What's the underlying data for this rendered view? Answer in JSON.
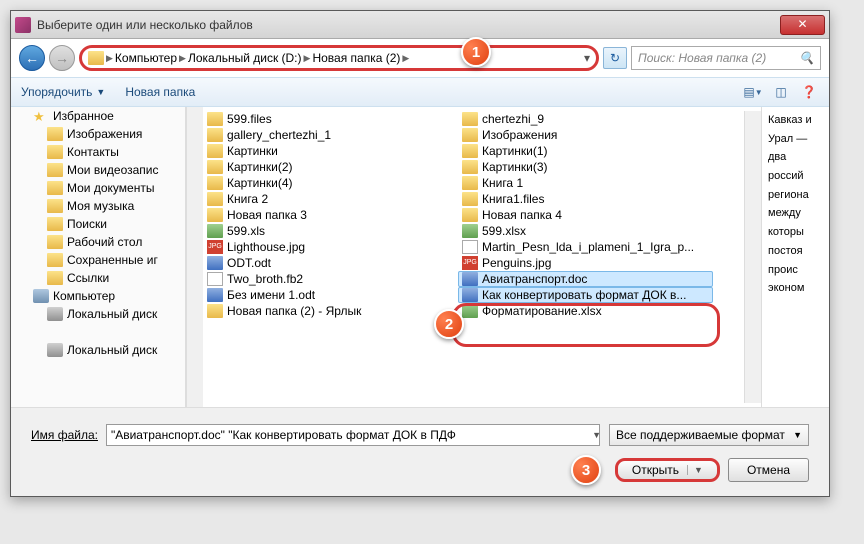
{
  "title": "Выберите один или несколько файлов",
  "breadcrumb": [
    "Компьютер",
    "Локальный диск (D:)",
    "Новая папка (2)"
  ],
  "search_placeholder": "Поиск: Новая папка (2)",
  "toolbar": {
    "organize": "Упорядочить",
    "newfolder": "Новая папка"
  },
  "sidebar": [
    {
      "label": "Избранное",
      "icon": "star"
    },
    {
      "label": "Изображения",
      "icon": "folder",
      "indent": 2
    },
    {
      "label": "Контакты",
      "icon": "folder",
      "indent": 2
    },
    {
      "label": "Мои видеозапис",
      "icon": "folder",
      "indent": 2
    },
    {
      "label": "Мои документы",
      "icon": "folder",
      "indent": 2
    },
    {
      "label": "Моя музыка",
      "icon": "folder",
      "indent": 2
    },
    {
      "label": "Поиски",
      "icon": "folder",
      "indent": 2
    },
    {
      "label": "Рабочий стол",
      "icon": "folder",
      "indent": 2
    },
    {
      "label": "Сохраненные иг",
      "icon": "folder",
      "indent": 2
    },
    {
      "label": "Ссылки",
      "icon": "folder",
      "indent": 2
    },
    {
      "label": "Компьютер",
      "icon": "comp"
    },
    {
      "label": "Локальный диск",
      "icon": "drive",
      "indent": 2
    },
    {
      "label": "",
      "icon": "",
      "indent": 2
    },
    {
      "label": "Локальный диск",
      "icon": "drive",
      "indent": 2
    }
  ],
  "files_col1": [
    {
      "name": "599.files",
      "icon": "folder"
    },
    {
      "name": "gallery_chertezhi_1",
      "icon": "folder"
    },
    {
      "name": "Картинки",
      "icon": "folder"
    },
    {
      "name": "Картинки(2)",
      "icon": "folder"
    },
    {
      "name": "Картинки(4)",
      "icon": "folder"
    },
    {
      "name": "Книга 2",
      "icon": "folder"
    },
    {
      "name": "Новая папка 3",
      "icon": "folder"
    },
    {
      "name": "599.xls",
      "icon": "xls"
    },
    {
      "name": "Lighthouse.jpg",
      "icon": "jpg"
    },
    {
      "name": "ODT.odt",
      "icon": "doc"
    },
    {
      "name": "Two_broth.fb2",
      "icon": "txt"
    },
    {
      "name": "Без имени 1.odt",
      "icon": "doc"
    },
    {
      "name": "Новая папка (2) - Ярлык",
      "icon": "folder"
    }
  ],
  "files_col2": [
    {
      "name": "chertezhi_9",
      "icon": "folder"
    },
    {
      "name": "Изображения",
      "icon": "folder"
    },
    {
      "name": "Картинки(1)",
      "icon": "folder"
    },
    {
      "name": "Картинки(3)",
      "icon": "folder"
    },
    {
      "name": "Книга 1",
      "icon": "folder"
    },
    {
      "name": "Книга1.files",
      "icon": "folder"
    },
    {
      "name": "Новая папка 4",
      "icon": "folder"
    },
    {
      "name": "599.xlsx",
      "icon": "xls"
    },
    {
      "name": "Martin_Pesn_lda_i_plameni_1_Igra_p...",
      "icon": "txt"
    },
    {
      "name": "Penguins.jpg",
      "icon": "jpg"
    },
    {
      "name": "Авиатранспорт.doc",
      "icon": "doc",
      "selected": true
    },
    {
      "name": "Как конвертировать формат ДОК в...",
      "icon": "doc",
      "selected": true
    },
    {
      "name": "Форматирование.xlsx",
      "icon": "xls"
    }
  ],
  "preview": "Кавказ и Урал — два россий региона между которы постоя проис эконом",
  "filename_label": "Имя файла:",
  "filename_value": "\"Авиатранспорт.doc\" \"Как конвертировать формат ДОК в ПДФ",
  "filter": "Все поддерживаемые формат",
  "open_btn": "Открыть",
  "cancel_btn": "Отмена",
  "callouts": {
    "c1": "1",
    "c2": "2",
    "c3": "3"
  }
}
